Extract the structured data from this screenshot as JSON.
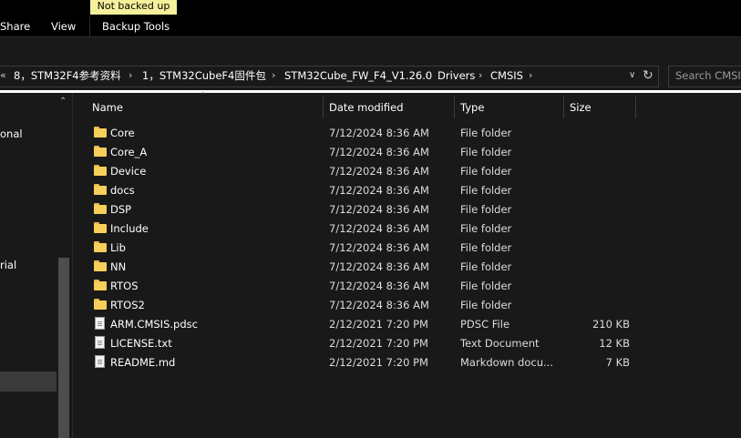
{
  "ribbon": {
    "badge": "Not backed up",
    "tabs": [
      "Share",
      "View",
      "Backup Tools"
    ]
  },
  "address": {
    "lead": "«",
    "crumbs": [
      "8，STM32F4参考资料",
      "1，STM32CubeF4固件包",
      "STM32Cube_FW_F4_V1.26.0",
      "Drivers",
      "CMSIS"
    ],
    "separator": "›"
  },
  "search": {
    "placeholder": "Search CMSIS"
  },
  "nav": {
    "items": [
      "onal",
      "rial"
    ]
  },
  "columns": {
    "name": "Name",
    "date": "Date modified",
    "type": "Type",
    "size": "Size"
  },
  "files": [
    {
      "name": "Core",
      "date": "7/12/2024 8:36 AM",
      "type": "File folder",
      "size": "",
      "icon": "folder-icon"
    },
    {
      "name": "Core_A",
      "date": "7/12/2024 8:36 AM",
      "type": "File folder",
      "size": "",
      "icon": "folder-icon"
    },
    {
      "name": "Device",
      "date": "7/12/2024 8:36 AM",
      "type": "File folder",
      "size": "",
      "icon": "folder-icon"
    },
    {
      "name": "docs",
      "date": "7/12/2024 8:36 AM",
      "type": "File folder",
      "size": "",
      "icon": "folder-icon"
    },
    {
      "name": "DSP",
      "date": "7/12/2024 8:36 AM",
      "type": "File folder",
      "size": "",
      "icon": "folder-icon"
    },
    {
      "name": "Include",
      "date": "7/12/2024 8:36 AM",
      "type": "File folder",
      "size": "",
      "icon": "folder-icon"
    },
    {
      "name": "Lib",
      "date": "7/12/2024 8:36 AM",
      "type": "File folder",
      "size": "",
      "icon": "folder-icon"
    },
    {
      "name": "NN",
      "date": "7/12/2024 8:36 AM",
      "type": "File folder",
      "size": "",
      "icon": "folder-icon"
    },
    {
      "name": "RTOS",
      "date": "7/12/2024 8:36 AM",
      "type": "File folder",
      "size": "",
      "icon": "folder-icon"
    },
    {
      "name": "RTOS2",
      "date": "7/12/2024 8:36 AM",
      "type": "File folder",
      "size": "",
      "icon": "folder-icon"
    },
    {
      "name": "ARM.CMSIS.pdsc",
      "date": "2/12/2021 7:20 PM",
      "type": "PDSC File",
      "size": "210 KB",
      "icon": "file-icon"
    },
    {
      "name": "LICENSE.txt",
      "date": "2/12/2021 7:20 PM",
      "type": "Text Document",
      "size": "12 KB",
      "icon": "text-file-icon"
    },
    {
      "name": "README.md",
      "date": "2/12/2021 7:20 PM",
      "type": "Markdown docu...",
      "size": "7 KB",
      "icon": "file-icon"
    }
  ],
  "colors": {
    "background": "#191919",
    "ribbon": "#000000",
    "badge": "#f5f09a",
    "folder": "#f6cf5a"
  }
}
